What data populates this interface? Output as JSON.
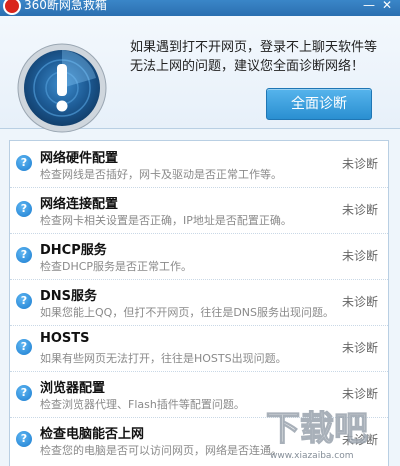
{
  "titlebar": {
    "title": "360断网急救箱",
    "minimize_glyph": "—",
    "close_glyph": "✕"
  },
  "header": {
    "message": "如果遇到打不开网页，登录不上聊天软件等无法上网的问题，建议您全面诊断网络！",
    "diagnose_button": "全面诊断",
    "icon": "alert-radar-icon"
  },
  "items": [
    {
      "title": "网络硬件配置",
      "desc": "检查网线是否插好，网卡及驱动是否正常工作等。",
      "status": "未诊断",
      "icon": "help-icon"
    },
    {
      "title": "网络连接配置",
      "desc": "检查网卡相关设置是否正确，IP地址是否配置正确。",
      "status": "未诊断",
      "icon": "help-icon"
    },
    {
      "title": "DHCP服务",
      "desc": "检查DHCP服务是否正常工作。",
      "status": "未诊断",
      "icon": "help-icon"
    },
    {
      "title": "DNS服务",
      "desc": "如果您能上QQ，但打不开网页，往往是DNS服务出现问题。",
      "status": "未诊断",
      "icon": "help-icon"
    },
    {
      "title": "HOSTS",
      "desc": "如果有些网页无法打开，往往是HOSTS出现问题。",
      "status": "未诊断",
      "icon": "help-icon"
    },
    {
      "title": "浏览器配置",
      "desc": "检查浏览器代理、Flash插件等配置问题。",
      "status": "未诊断",
      "icon": "help-icon"
    },
    {
      "title": "检查电脑能否上网",
      "desc": "检查您的电脑是否可以访问网页，网络是否连通。",
      "status": "未诊断",
      "icon": "help-icon"
    }
  ],
  "icon_glyph": "?",
  "watermark": {
    "text": "下载吧",
    "domain": "www.xiazaiba.com"
  },
  "colors": {
    "accent": "#2a8fd1",
    "titlebar": "#2b6fb0"
  }
}
